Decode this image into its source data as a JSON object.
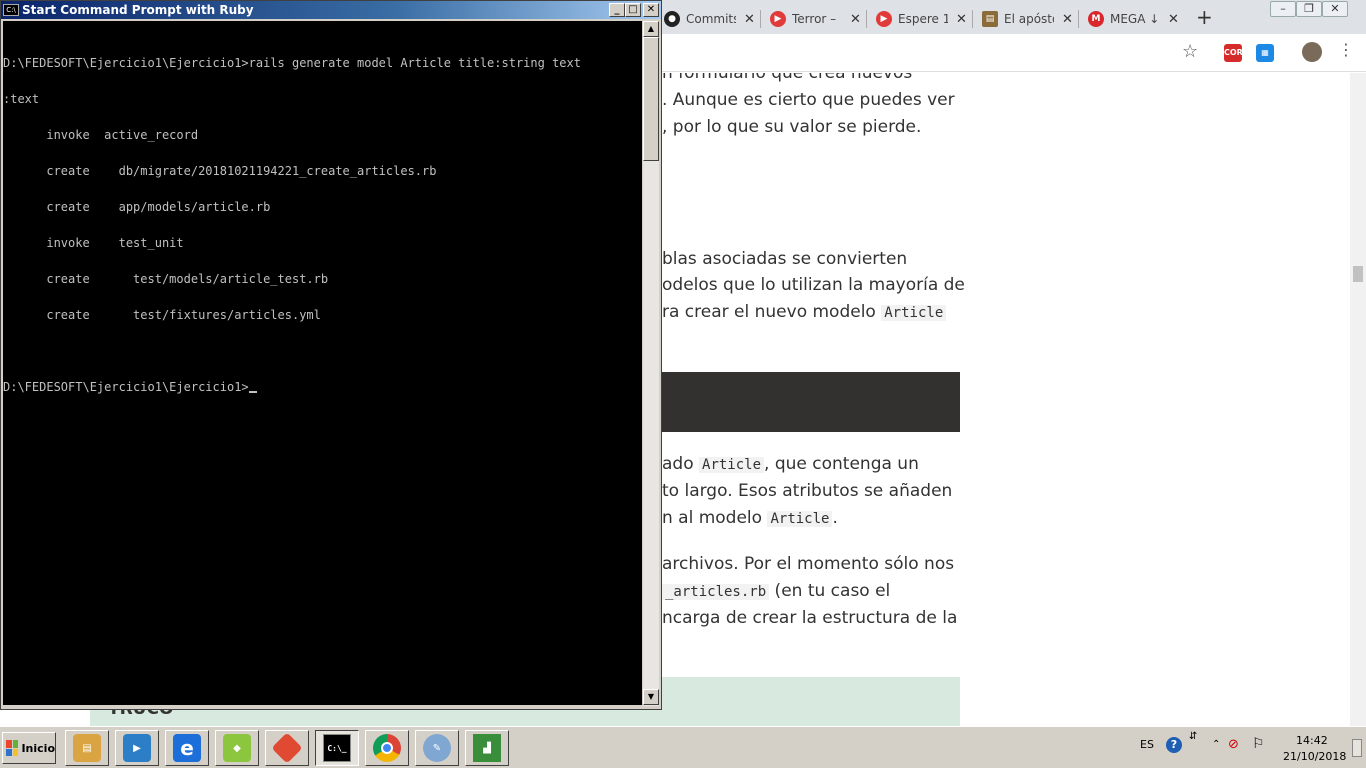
{
  "browser": {
    "tabs": [
      {
        "label": "Commits",
        "icon": "github-icon"
      },
      {
        "label": "Terror –",
        "icon": "youtube-icon"
      },
      {
        "label": "Espere 1",
        "icon": "youtube-icon"
      },
      {
        "label": "El apósto",
        "icon": "clipboard-icon"
      },
      {
        "label": "MEGA ↓",
        "icon": "mega-icon"
      }
    ],
    "extensions": {
      "cors": "CORS"
    },
    "page_lines": [
      {
        "text": "n formulario que crea nuevos"
      },
      {
        "text": ". Aunque es cierto que puedes ver"
      },
      {
        "text": ", por lo que su valor se pierde."
      },
      {
        "text": "blas asociadas se convierten"
      },
      {
        "text": "odelos que lo utilizan la mayoría de"
      },
      {
        "text_before": "ra crear el nuevo modelo ",
        "code": "Article"
      },
      {
        "text_before": "ado ",
        "code": "Article",
        "text_after": ", que contenga un"
      },
      {
        "text": "to largo. Esos atributos se añaden"
      },
      {
        "text_before": "n al modelo ",
        "code": "Article",
        "text_after": "."
      },
      {
        "text": "archivos. Por el momento sólo nos"
      },
      {
        "code": "_articles.rb",
        "text_after": " (en tu caso el"
      },
      {
        "text": "ncarga de crear la estructura de la"
      }
    ],
    "tip_label": "TRUCO"
  },
  "cmd": {
    "title": "Start Command Prompt with Ruby",
    "lines": [
      "D:\\FEDESOFT\\Ejercicio1\\Ejercicio1>rails generate model Article title:string text",
      ":text",
      "      invoke  active_record",
      "      create    db/migrate/20181021194221_create_articles.rb",
      "      create    app/models/article.rb",
      "      invoke    test_unit",
      "      create      test/models/article_test.rb",
      "      create      test/fixtures/articles.yml",
      "",
      "D:\\FEDESOFT\\Ejercicio1\\Ejercicio1>"
    ],
    "buttons": {
      "minimize": "_",
      "maximize": "□",
      "close": "✕"
    }
  },
  "taskbar": {
    "start_label": "Inicio",
    "apps": [
      {
        "name": "file-manager-icon",
        "label": "",
        "color": "#d9a441"
      },
      {
        "name": "media-player-icon",
        "label": "",
        "color": "#2c7fc6"
      },
      {
        "name": "internet-explorer-icon",
        "label": "e",
        "color": "#1c6fd8"
      },
      {
        "name": "notes-icon",
        "label": "",
        "color": "#8cc63f"
      },
      {
        "name": "git-icon",
        "label": "",
        "color": "#e04a32"
      },
      {
        "name": "command-prompt-icon",
        "label": "C:\\_",
        "color": "#000000"
      },
      {
        "name": "chrome-icon",
        "label": "",
        "color": "#db4437"
      },
      {
        "name": "paint-icon",
        "label": "",
        "color": "#7fa7d1"
      },
      {
        "name": "chart-app-icon",
        "label": "",
        "color": "#3a8d3a"
      }
    ],
    "tray": {
      "language": "ES",
      "time": "14:42",
      "date": "21/10/2018"
    }
  }
}
